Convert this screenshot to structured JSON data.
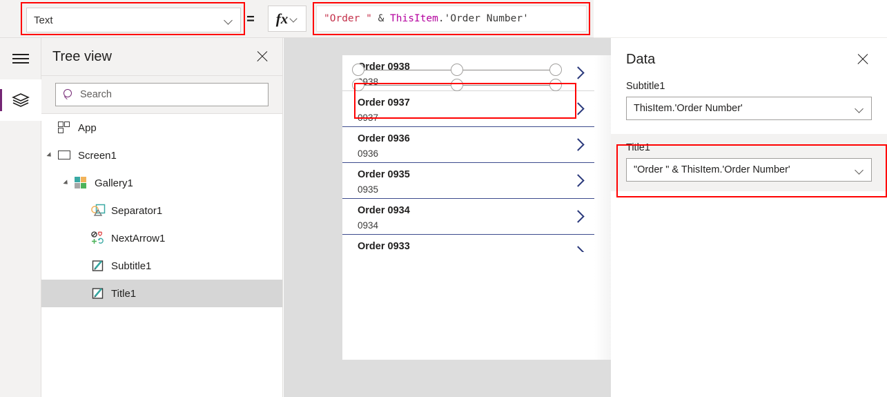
{
  "topbar": {
    "property_dropdown": {
      "value": "Text",
      "icon": "chevron-down-icon"
    },
    "equals": "=",
    "fx_button": {
      "glyph": "fx",
      "icon": "chevron-down-icon"
    },
    "formula": {
      "full_text": "\"Order \" & ThisItem.'Order Number'",
      "tokens": {
        "string": "\"Order \"",
        "space1": " ",
        "operator": "&",
        "space2": " ",
        "identifier": "ThisItem",
        "rest": ".'Order Number'"
      }
    }
  },
  "rail": {
    "menu_icon": "hamburger-menu-icon",
    "layers_icon": "layers-icon",
    "accent": "#742774"
  },
  "treeview": {
    "title": "Tree view",
    "close_icon": "close-icon",
    "search": {
      "placeholder": "Search",
      "icon": "search-icon"
    },
    "items": [
      {
        "label": "App",
        "icon": "app-icon",
        "depth": 0,
        "twisty": "none",
        "selected": false
      },
      {
        "label": "Screen1",
        "icon": "screen-icon",
        "depth": 0,
        "twisty": "expanded",
        "selected": false
      },
      {
        "label": "Gallery1",
        "icon": "gallery-icon",
        "depth": 1,
        "twisty": "expanded",
        "selected": false
      },
      {
        "label": "Separator1",
        "icon": "separator-icon",
        "depth": 2,
        "twisty": "none",
        "selected": false
      },
      {
        "label": "NextArrow1",
        "icon": "nextarrow-icon",
        "depth": 2,
        "twisty": "none",
        "selected": false
      },
      {
        "label": "Subtitle1",
        "icon": "label-icon",
        "depth": 2,
        "twisty": "none",
        "selected": false
      },
      {
        "label": "Title1",
        "icon": "label-icon",
        "depth": 2,
        "twisty": "none",
        "selected": true
      }
    ]
  },
  "canvas": {
    "gallery": {
      "items": [
        {
          "title": "Order 0938",
          "subtitle": "0938",
          "arrow_icon": "chevron-right-icon",
          "selected": true
        },
        {
          "title": "Order 0937",
          "subtitle": "0937",
          "arrow_icon": "chevron-right-icon",
          "selected": false
        },
        {
          "title": "Order 0936",
          "subtitle": "0936",
          "arrow_icon": "chevron-right-icon",
          "selected": false
        },
        {
          "title": "Order 0935",
          "subtitle": "0935",
          "arrow_icon": "chevron-right-icon",
          "selected": false
        },
        {
          "title": "Order 0934",
          "subtitle": "0934",
          "arrow_icon": "chevron-right-icon",
          "selected": false
        },
        {
          "title": "Order 0933",
          "subtitle": "",
          "arrow_icon": "chevron-right-icon",
          "selected": false
        }
      ]
    },
    "selection_highlight_color": "#ff0000"
  },
  "datapanel": {
    "title": "Data",
    "close_icon": "close-icon",
    "fields": [
      {
        "label": "Subtitle1",
        "value": "ThisItem.'Order Number'",
        "icon": "chevron-down-icon",
        "highlighted": false
      },
      {
        "label": "Title1",
        "value": "\"Order \" & ThisItem.'Order Number'",
        "icon": "chevron-down-icon",
        "highlighted": true
      }
    ],
    "highlight_color": "#ff0000"
  }
}
